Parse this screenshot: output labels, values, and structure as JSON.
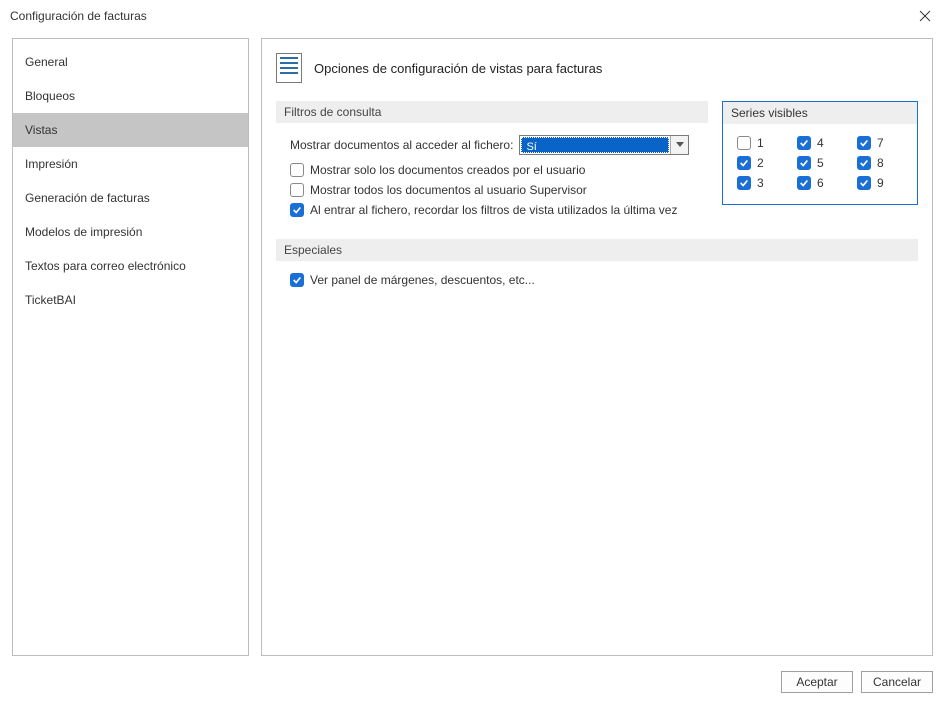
{
  "window": {
    "title": "Configuración de facturas"
  },
  "sidebar": {
    "items": [
      {
        "label": "General",
        "active": false
      },
      {
        "label": "Bloqueos",
        "active": false
      },
      {
        "label": "Vistas",
        "active": true
      },
      {
        "label": "Impresión",
        "active": false
      },
      {
        "label": "Generación de facturas",
        "active": false
      },
      {
        "label": "Modelos de impresión",
        "active": false
      },
      {
        "label": "Textos para correo electrónico",
        "active": false
      },
      {
        "label": "TicketBAI",
        "active": false
      }
    ]
  },
  "main": {
    "heading": "Opciones de configuración de vistas para facturas",
    "sections": {
      "filters_title": "Filtros de consulta",
      "specials_title": "Especiales"
    },
    "filters": {
      "show_docs_label": "Mostrar documentos al acceder al fichero:",
      "show_docs_value": "Sí",
      "only_own_docs": {
        "label": "Mostrar solo los documentos creados por el usuario",
        "checked": false
      },
      "all_docs_supervisor": {
        "label": "Mostrar todos los documentos al usuario Supervisor",
        "checked": false
      },
      "remember_filters": {
        "label": "Al entrar al fichero, recordar los filtros de vista utilizados la última vez",
        "checked": true
      }
    },
    "series": {
      "title": "Series visibles",
      "items": [
        {
          "label": "1",
          "checked": false
        },
        {
          "label": "4",
          "checked": true
        },
        {
          "label": "7",
          "checked": true
        },
        {
          "label": "2",
          "checked": true
        },
        {
          "label": "5",
          "checked": true
        },
        {
          "label": "8",
          "checked": true
        },
        {
          "label": "3",
          "checked": true
        },
        {
          "label": "6",
          "checked": true
        },
        {
          "label": "9",
          "checked": true
        }
      ]
    },
    "specials": {
      "margins_panel": {
        "label": "Ver panel de márgenes, descuentos, etc...",
        "checked": true
      }
    }
  },
  "footer": {
    "accept": "Aceptar",
    "cancel": "Cancelar"
  }
}
